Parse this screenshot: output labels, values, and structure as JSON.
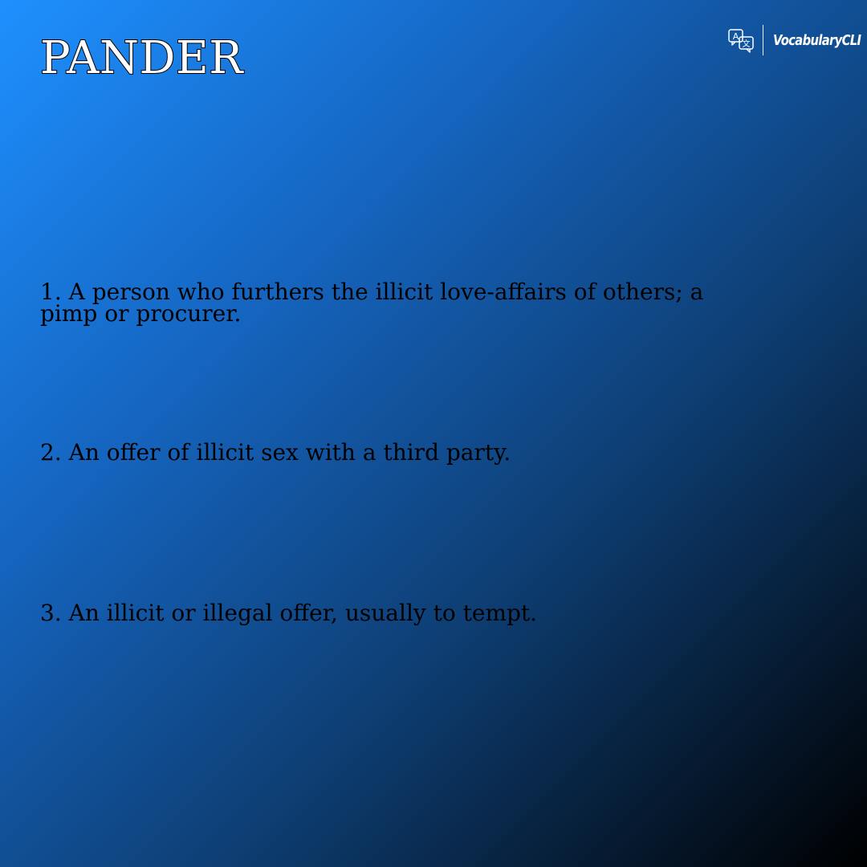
{
  "word": "PANDER",
  "brand": {
    "name": "VocabularyCLI",
    "icon": "translate-icon",
    "icon_glyphs": [
      "A",
      "文"
    ]
  },
  "definitions": [
    "1. A person who furthers the illicit love-affairs of others; a pimp or procurer.",
    "2. An offer of illicit sex with a third party.",
    "3. An illicit or illegal offer, usually to tempt."
  ],
  "colors": {
    "gradient_start": "#1e90ff",
    "gradient_end": "#000000",
    "word_fill": "#ffffff",
    "word_outline": "#000000",
    "definition_text": "#000000"
  }
}
